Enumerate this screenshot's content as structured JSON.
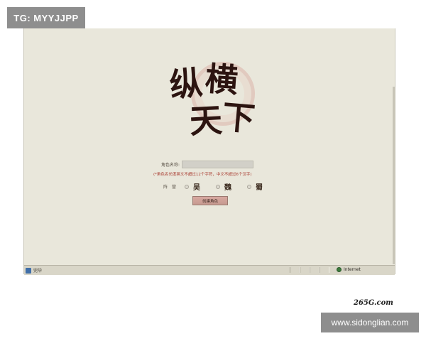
{
  "watermark": {
    "tag": "TG: MYYJJPP",
    "site_logo": "265G.com",
    "site_url": "www.sidonglian.com"
  },
  "logo": {
    "glyphs": [
      "纵",
      "横",
      "天",
      "下"
    ]
  },
  "form": {
    "name_label": "角色名称:",
    "name_value": "",
    "hint": "(*角色名长度英文不超过12个字符，中文不超过6个汉字)",
    "camp_label": "阵　营",
    "camps": [
      "吴",
      "魏",
      "蜀"
    ],
    "create_button": "创建角色"
  },
  "statusbar": {
    "status": "完毕",
    "zone": "Internet"
  },
  "colors": {
    "background": "#e9e7db",
    "hint": "#a83a2e",
    "button": "#d8a8a0"
  }
}
